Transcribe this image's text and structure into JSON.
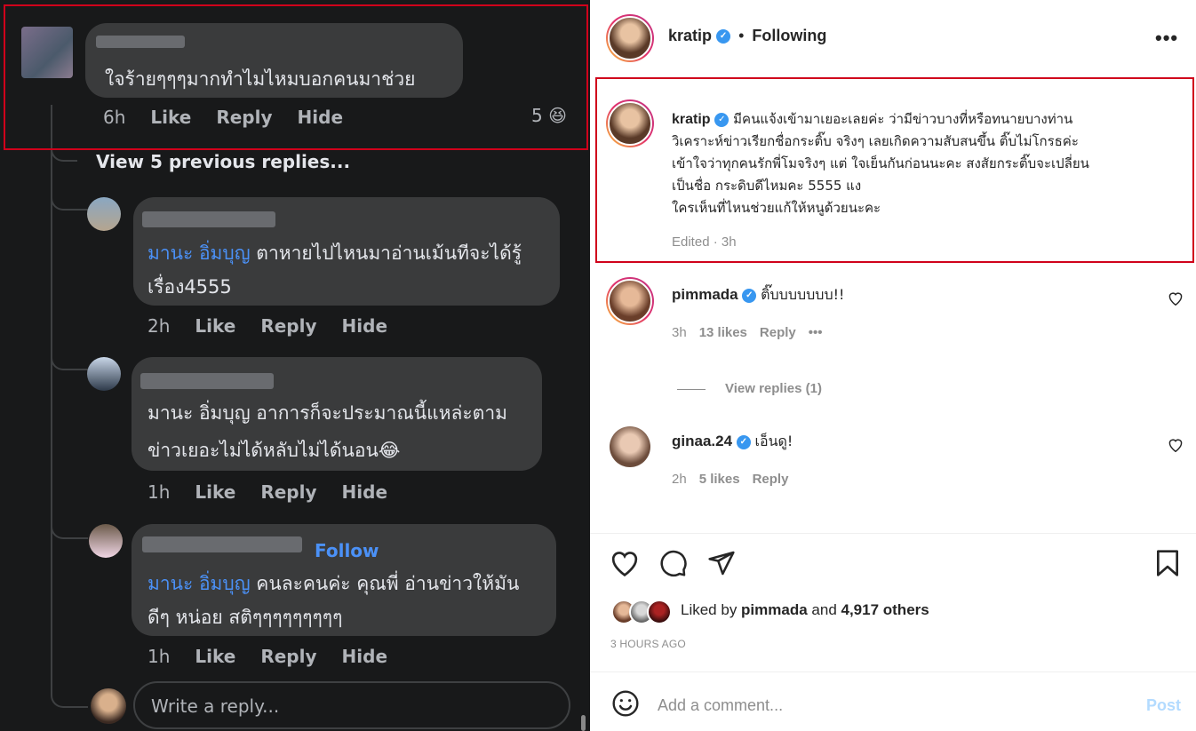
{
  "facebook": {
    "top_comment": {
      "text": "ใจร้ายๆๆๆมากทำไมไหมบอกคนมาช่วย",
      "time": "6h",
      "like": "Like",
      "reply": "Reply",
      "hide": "Hide",
      "reaction_count": "5",
      "reaction_emoji": "😆"
    },
    "view_previous": "View 5 previous replies...",
    "replies": [
      {
        "mention": "มานะ อิ่มบุญ",
        "text": " ตาหายไปไหนมาอ่านเม้นทีจะได้รู้",
        "text2": "เรื่อง4555",
        "time": "2h",
        "like": "Like",
        "reply": "Reply",
        "hide": "Hide"
      },
      {
        "mention": "มานะ อิ่มบุญ",
        "text": " อาการก็จะประมาณนี้แหล่ะตาม",
        "text2": "ข่าวเยอะไม่ได้หลับไม่ได้นอน😂",
        "time": "1h",
        "like": "Like",
        "reply": "Reply",
        "hide": "Hide"
      },
      {
        "mention": "มานะ อิ่มบุญ",
        "text": " คนละคนค่ะ คุณพี่ อ่านข่าวให้มัน",
        "text2": "ดีๆ หน่อย สติๆๆๆๆๆๆๆๆๆ",
        "time": "1h",
        "like": "Like",
        "reply": "Reply",
        "hide": "Hide",
        "follow": "Follow"
      }
    ],
    "write_reply_placeholder": "Write a reply..."
  },
  "instagram": {
    "header": {
      "username": "kratip",
      "dot": "•",
      "following": "Following"
    },
    "caption": {
      "username": "kratip",
      "lines": [
        "มีคนแจ้งเข้ามาเยอะเลยค่ะ ว่ามีข่าวบางที่หรือทนายบางท่าน",
        "วิเคราะห์ข่าวเรียกชื่อกระติ๊บ จริงๆ เลยเกิดความสับสนขึ้น ติ๊บไม่โกรธค่ะ",
        "เข้าใจว่าทุกคนรักพี่โมจริงๆ แต่ ใจเย็นกันก่อนนะคะ สงสัยกระติ๊บจะเปลี่ยน",
        "เป็นชื่อ กระดิบดีไหมคะ 5555 แง",
        "ใครเห็นที่ไหนช่วยแก้ให้หนูด้วยนะคะ"
      ],
      "edited": "Edited · 3h"
    },
    "comments": [
      {
        "username": "pimmada",
        "text": "ติ๊บบบบบบบ!!",
        "time": "3h",
        "likes": "13 likes",
        "reply": "Reply",
        "view_replies": "View replies (1)"
      },
      {
        "username": "ginaa.24",
        "text": "เอ็นดู!",
        "time": "2h",
        "likes": "5 likes",
        "reply": "Reply"
      }
    ],
    "liked_by_prefix": "Liked by ",
    "liked_by_user": "pimmada",
    "liked_by_and": " and ",
    "liked_by_others": "4,917 others",
    "timestamp": "3 HOURS AGO",
    "add_comment_placeholder": "Add a comment...",
    "post_label": "Post"
  }
}
